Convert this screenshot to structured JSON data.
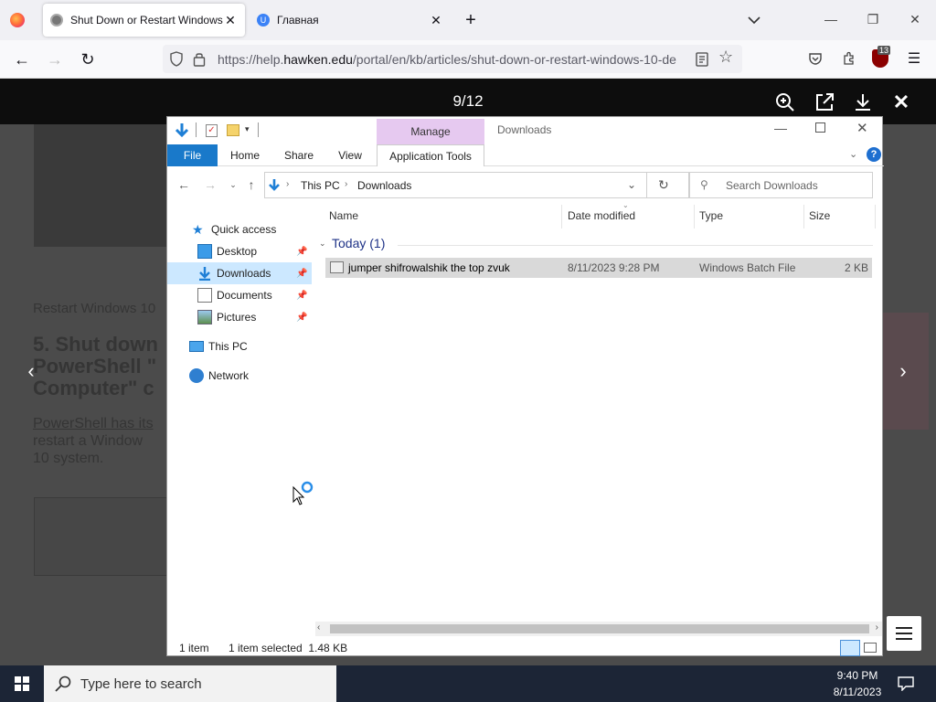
{
  "browser": {
    "tabs": [
      {
        "title": "Shut Down or Restart Windows",
        "active": true
      },
      {
        "title": "Главная",
        "active": false
      }
    ],
    "url_prefix": "https://help.",
    "url_domain": "hawken.edu",
    "url_path": "/portal/en/kb/articles/shut-down-or-restart-windows-10-de",
    "extension_badge": "13"
  },
  "lightbox": {
    "counter": "9/12"
  },
  "background_article": {
    "line1": "Restart Windows 10",
    "heading": "5. Shut down",
    "heading2": "PowerShell \"",
    "heading3": "Computer\" c",
    "para1": "PowerShell has its",
    "para2": "restart a Window",
    "para3": "10 system."
  },
  "explorer": {
    "title": "Downloads",
    "context_tab": "Manage",
    "ribbon_tabs": [
      "File",
      "Home",
      "Share",
      "View",
      "Application Tools"
    ],
    "address": {
      "root": "This PC",
      "current": "Downloads"
    },
    "search_placeholder": "Search Downloads",
    "nav": {
      "quick_access": "Quick access",
      "desktop": "Desktop",
      "downloads": "Downloads",
      "documents": "Documents",
      "pictures": "Pictures",
      "this_pc": "This PC",
      "network": "Network"
    },
    "columns": [
      "Name",
      "Date modified",
      "Type",
      "Size"
    ],
    "group_label": "Today (1)",
    "files": [
      {
        "name": "jumper shifrowalshik the top zvuk",
        "date": "8/11/2023 9:28 PM",
        "type": "Windows Batch File",
        "size": "2 KB"
      }
    ],
    "status": {
      "count": "1 item",
      "selected": "1 item selected  1.48 KB"
    }
  },
  "taskbar": {
    "search_placeholder": "Type here to search",
    "time": "9:40 PM",
    "date": "8/11/2023"
  },
  "colors": {
    "file_tab": "#1979ca",
    "manage_tab": "#e6c9f0",
    "selection": "#cce8ff",
    "taskbar": "#1c2536"
  }
}
